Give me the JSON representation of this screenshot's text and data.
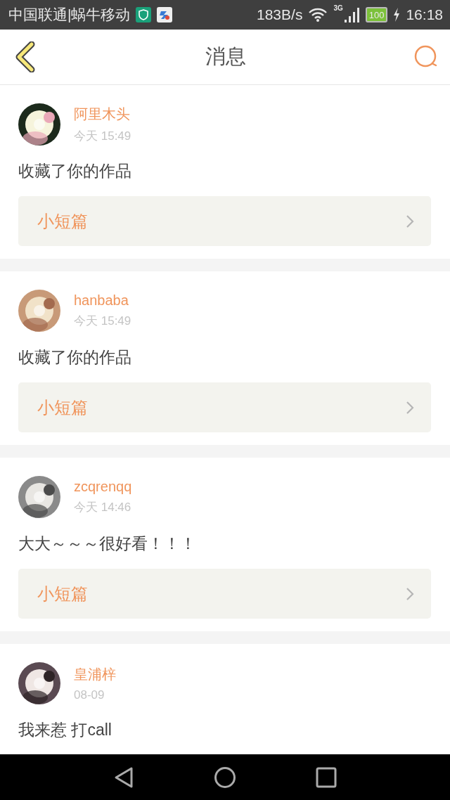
{
  "status_bar": {
    "carrier": "中国联通|蜗牛移动",
    "speed": "183B/s",
    "network": "3G",
    "battery": "100",
    "time": "16:18"
  },
  "header": {
    "title": "消息"
  },
  "messages": [
    {
      "user": "阿里木头",
      "time": "今天 15:49",
      "text": "收藏了你的作品",
      "work": "小短篇"
    },
    {
      "user": "hanbaba",
      "time": "今天 15:49",
      "text": "收藏了你的作品",
      "work": "小短篇"
    },
    {
      "user": "zcqrenqq",
      "time": "今天 14:46",
      "text": "大大～～～很好看！！！",
      "work": "小短篇"
    },
    {
      "user": "皇浦梓",
      "time": "08-09",
      "text": "我来惹 打call"
    }
  ]
}
